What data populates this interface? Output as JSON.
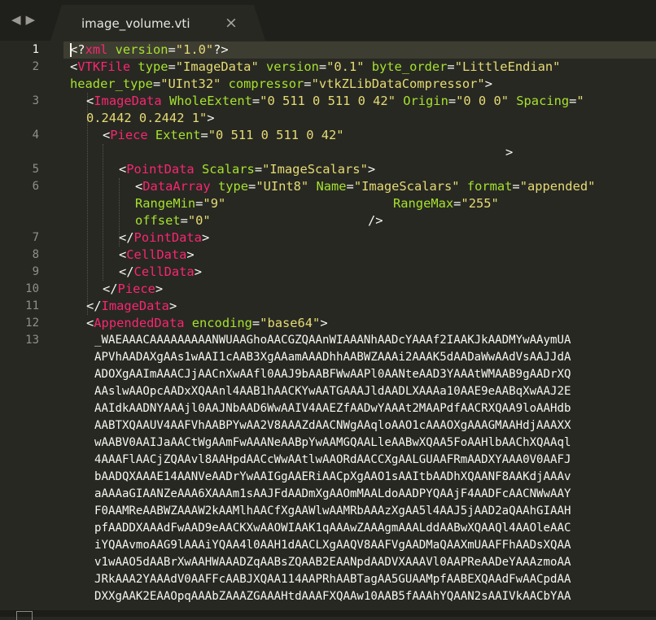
{
  "window": {
    "back_arrow": "◀",
    "forward_arrow": "▶",
    "tab_title": "image_volume.vti",
    "tab_close": "×"
  },
  "editor": {
    "line_numbers": [
      "1",
      "2",
      "3",
      "4",
      "5",
      "6",
      "7",
      "8",
      "9",
      "10",
      "11",
      "12",
      "13"
    ],
    "current_line": "1",
    "status_icon": "panel-toggle-icon",
    "colors": {
      "background": "#272822",
      "tag": "#f92672",
      "attribute": "#a6e22e",
      "string": "#e6db74",
      "text": "#f8f8f2",
      "line_highlight": "#3e3d32"
    }
  },
  "code": {
    "l1": [
      "<",
      "?",
      "xml",
      " version",
      "=",
      "\"1.0\"",
      "?>"
    ],
    "l2a": [
      "<",
      "VTKFile",
      " type",
      "=",
      "\"ImageData\"",
      " version",
      "=",
      "\"0.1\"",
      " byte_order",
      "=",
      "\"LittleEndian\""
    ],
    "l2b": [
      "header_type",
      "=",
      "\"UInt32\"",
      " compressor",
      "=",
      "\"vtkZLibDataCompressor\"",
      ">"
    ],
    "l3a": [
      "<",
      "ImageData",
      " WholeExtent",
      "=",
      "\"0 511 0 511 0 42\"",
      " Origin",
      "=",
      "\"0 0 0\"",
      " Spacing",
      "=",
      "\""
    ],
    "l3b": [
      "0.2442 0.2442 1\"",
      ">"
    ],
    "l4": [
      "<",
      "Piece",
      " Extent",
      "=",
      "\"0 511 0 511 0 42\""
    ],
    "l4b": [
      ">"
    ],
    "l5": [
      "<",
      "PointData",
      " Scalars",
      "=",
      "\"ImageScalars\"",
      ">"
    ],
    "l6a": [
      "<",
      "DataArray",
      " type",
      "=",
      "\"UInt8\"",
      " Name",
      "=",
      "\"ImageScalars\"",
      " format",
      "=",
      "\"appended\""
    ],
    "l6b": [
      "RangeMin",
      "=",
      "\"9\"",
      "RangeMax",
      "=",
      "\"255\""
    ],
    "l6c": [
      "offset",
      "=",
      "\"0\"",
      "/>"
    ],
    "l7": [
      "</",
      "PointData",
      ">"
    ],
    "l8": [
      "<",
      "CellData",
      ">"
    ],
    "l9": [
      "</",
      "CellData",
      ">"
    ],
    "l10": [
      "</",
      "Piece",
      ">"
    ],
    "l11": [
      "</",
      "ImageData",
      ">"
    ],
    "l12": [
      "<",
      "AppendedData",
      " encoding",
      "=",
      "\"base64\"",
      ">"
    ],
    "b64": [
      "_WAEAAACAAAAAAAAANWUAAGhoAACGZQAAnWIAAANhAADcYAAAf2IAAKJkAADMYwAAymUA",
      "APVhAADAXgAAs1wAAI1cAAB3XgAAamAAADhhAABWZAAAi2AAAK5dAADaWwAAdVsAAJJdA",
      "ADOXgAAImAAACJjAACnXwAAfl0AAJ9bAABFWwAAPl0AANteAAD3YAAAtWMAAB9gAADrXQ",
      "AAslwAAOpcAADxXQAAnl4AAB1hAACKYwAATGAAAJldAADLXAAAa10AAE9eAABqXwAAJ2E",
      "AAIdkAADNYAAAjl0AAJNbAAD6WwAAIV4AAEZfAADwYAAAt2MAAPdfAACRXQAA9loAAHdb",
      "AABTXQAAUV4AAFVhAABPYwAA2V8AAAZdAACNWgAAqloAAO1cAAAOXgAAAGMAAHdjAAAXX",
      "wAABV0AAIJaAACtWgAAmFwAAANeAABpYwAAMGQAALleAABwXQAA5FoAAHlbAAChXQAAql",
      "4AAAFlAACjZQAAvl8AAHpdAACcWwAAtlwAAORdAACCXgAALGUAAFRmAADXYAAA0V0AAFJ",
      "bAADQXAAAE14AANVeAADrYwAAIGgAAERiAACpXgAAO1sAAItbAADhXQAANF8AAKdjAAAv",
      "aAAAaGIAANZeAAA6XAAAm1sAAJFdAADmXgAAOmMAALdoAADPYQAAjF4AADFcAACNWwAAY",
      "F0AAMReAABWZAAAW2kAAMlhAACfXgAAWlwAAMRbAAAzXgAA5l4AAJ5jAAD2aQAAhGIAAH",
      "pfAADDXAAAdFwAAD9eAACKXwAAOWIAAK1qAAAwZAAAgmAAALddAABwXQAAQl4AAOleAAC",
      "iYQAAvmoAAG9lAAAiYQAA4l0AAH1dAACLXgAAQV8AAFVgAADMaQAAXmUAAFFhAADsXQAA",
      "v1wAAO5dAABrXwAAHWAAADZqAABsZQAAB2EAANpdAADVXAAAVl0AAPReAADeYAAAzmoAA",
      "JRkAAA2YAAAdV0AAFFcAABJXQAA114AAPRhAABTagAA5GUAAMpfAABEXQAAdFwAACpdAA",
      "DXXgAAK2EAAOpqAAAbZAAAZGAAAHtdAAAFXQAAw10AAB5fAAAhYQAAN2sAAIVkAACbYAA"
    ]
  }
}
